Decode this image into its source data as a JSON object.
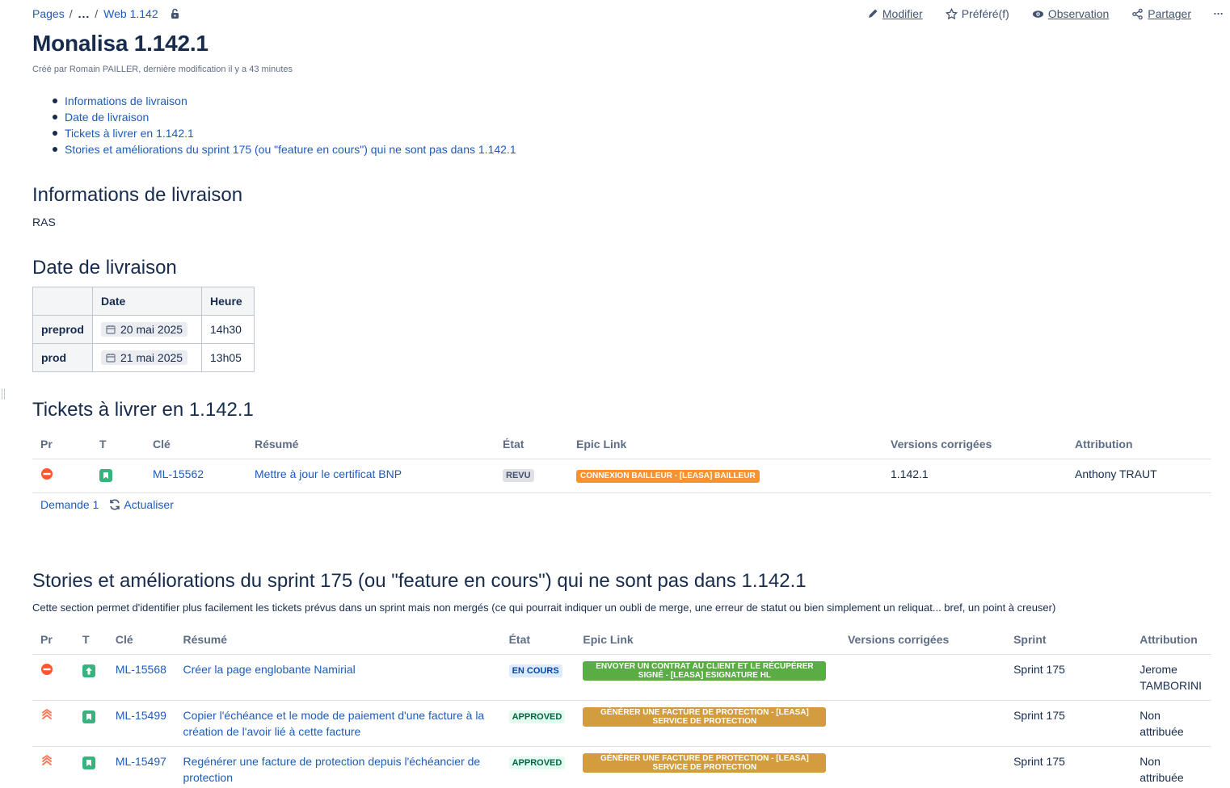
{
  "breadcrumb": {
    "pages": "Pages",
    "ellipsis": "...",
    "current": "Web 1.142"
  },
  "actions": {
    "edit": "Modifier",
    "favorite": "Préféré(f)",
    "watch": "Observation",
    "share": "Partager"
  },
  "page": {
    "title": "Monalisa 1.142.1",
    "byline": "Créé par Romain PAILLER, dernière modification il y a 43 minutes"
  },
  "toc": [
    "Informations de livraison",
    "Date de livraison",
    "Tickets à livrer en 1.142.1",
    "Stories et améliorations du sprint 175 (ou \"feature en cours\") qui ne sont pas dans 1.142.1"
  ],
  "sections": {
    "info": {
      "title": "Informations de livraison",
      "body": "RAS"
    },
    "date": {
      "title": "Date de livraison",
      "headers": [
        "",
        "Date",
        "Heure"
      ],
      "rows": [
        {
          "label": "preprod",
          "date": "20 mai 2025",
          "time": "14h30"
        },
        {
          "label": "prod",
          "date": "21 mai 2025",
          "time": "13h05"
        }
      ]
    },
    "tickets": {
      "title": "Tickets à livrer en 1.142.1",
      "headers": [
        "Pr",
        "T",
        "Clé",
        "Résumé",
        "État",
        "Epic Link",
        "Versions corrigées",
        "Attribution"
      ],
      "rows": [
        {
          "key": "ML-15562",
          "summary": "Mettre à jour le certificat BNP",
          "status": "REVU",
          "epic": "CONNEXION BAILLEUR - [LEASA] BAILLEUR",
          "epic_color": "#f79232",
          "version": "1.142.1",
          "assignee": "Anthony TRAUT"
        }
      ],
      "footer_count": "Demande 1",
      "footer_refresh": "Actualiser"
    },
    "stories": {
      "title": "Stories et améliorations du sprint 175 (ou \"feature en cours\") qui ne sont pas dans 1.142.1",
      "description": "Cette section permet d'identifier plus facilement les tickets prévus dans un sprint mais non mergés (ce qui pourrait indiquer un oubli de merge, une erreur de statut ou bien simplement un reliquat... bref, un point à creuser)",
      "headers": [
        "Pr",
        "T",
        "Clé",
        "Résumé",
        "État",
        "Epic Link",
        "Versions corrigées",
        "Sprint",
        "Attribution"
      ],
      "rows": [
        {
          "priority": "blocker",
          "type": "improvement",
          "key": "ML-15568",
          "summary": "Créer la page englobante Namirial",
          "status": "EN COURS",
          "status_kind": "blue",
          "epic": "ENVOYER UN CONTRAT AU CLIENT ET LE RÉCUPÉRER SIGNÉ - [LEASA] ESIGNATURE HL",
          "epic_color": "#5aac44",
          "version": "",
          "sprint": "Sprint 175",
          "assignee": "Jerome TAMBORINI"
        },
        {
          "priority": "highest",
          "type": "story",
          "key": "ML-15499",
          "summary": "Copier l'échéance et le mode de paiement d'une facture à la création de l'avoir lié à cette facture",
          "status": "APPROVED",
          "status_kind": "green",
          "epic": "GÉNÉRER UNE FACTURE DE PROTECTION - [LEASA] SERVICE DE PROTECTION",
          "epic_color": "#d39c3f",
          "version": "",
          "sprint": "Sprint 175",
          "assignee": "Non attribuée"
        },
        {
          "priority": "highest",
          "type": "story",
          "key": "ML-15497",
          "summary": "Regénérer une facture de protection depuis l'échéancier de protection",
          "status": "APPROVED",
          "status_kind": "green",
          "epic": "GÉNÉRER UNE FACTURE DE PROTECTION - [LEASA] SERVICE DE PROTECTION",
          "epic_color": "#d39c3f",
          "version": "",
          "sprint": "Sprint 175",
          "assignee": "Non attribuée"
        }
      ]
    }
  },
  "icons": {
    "blocker": "blocker-priority-icon",
    "highest": "highest-priority-icon",
    "story": "story-type-icon",
    "improvement": "improvement-type-icon"
  },
  "colors": {
    "link": "#1d5bbd",
    "story": "#36b37e",
    "blocker": "#ff5630",
    "highest": "#ff7452"
  }
}
